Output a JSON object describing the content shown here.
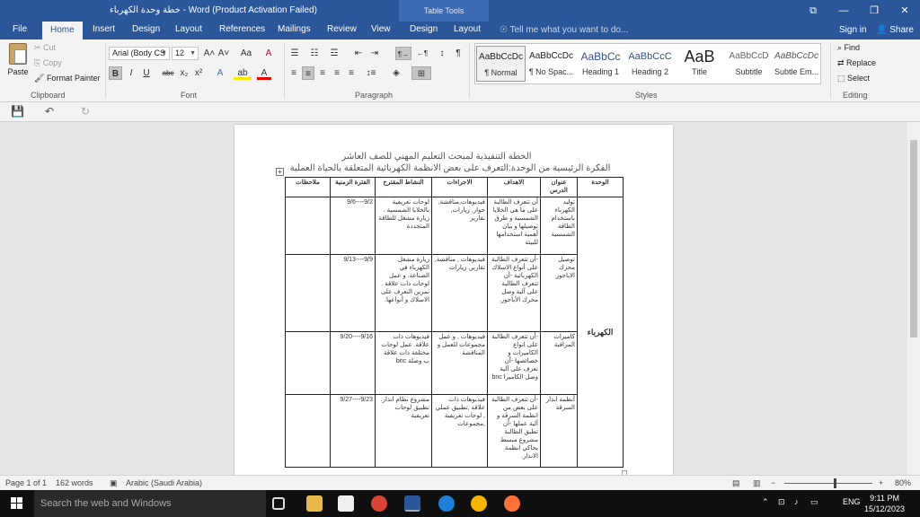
{
  "window": {
    "title": "خطة وحدة الكهرباء - Word (Product Activation Failed)",
    "context_tab": "Table Tools",
    "controls": [
      "⧉",
      "—",
      "❐",
      "✕"
    ]
  },
  "quick_access": {
    "save": "💾",
    "undo": "↶",
    "redo": "↻"
  },
  "tabs": [
    "File",
    "Home",
    "Insert",
    "Design",
    "Layout",
    "References",
    "Mailings",
    "Review",
    "View",
    "Design",
    "Layout"
  ],
  "active_tab": "Home",
  "tell_me": "Tell me what you want to do...",
  "sign_in": "Sign in",
  "share": "Share",
  "clipboard": {
    "label": "Clipboard",
    "paste": "Paste",
    "cut": "Cut",
    "copy": "Copy",
    "format_painter": "Format Painter"
  },
  "font": {
    "label": "Font",
    "name": "Arial (Body CS",
    "size": "12",
    "grow": "A˄",
    "shrink": "A˅",
    "change_case": "Aa",
    "clear": "A",
    "bold": "B",
    "italic": "I",
    "underline": "U",
    "strike": "abc",
    "subscript": "x₂",
    "superscript": "x²",
    "effects": "A",
    "highlight": "ab",
    "color": "A"
  },
  "paragraph": {
    "label": "Paragraph",
    "bullets": "☰",
    "numbering": "☷",
    "multilevel": "☲",
    "decrease_indent": "⇤",
    "increase_indent": "⇥",
    "ltr": "¶→",
    "rtl": "←¶",
    "sort": "↕",
    "show_marks": "¶",
    "align_left": "≡",
    "align_center": "≡",
    "align_right": "≡",
    "justify": "≡",
    "distributed": "≡",
    "line_spacing": "↕≡",
    "shading": "◈",
    "borders": "⊞"
  },
  "styles": {
    "label": "Styles",
    "items": [
      {
        "sample": "AaBbCcDc",
        "name": "¶ Normal"
      },
      {
        "sample": "AaBbCcDc",
        "name": "¶ No Spac..."
      },
      {
        "sample": "AaBbCc",
        "name": "Heading 1"
      },
      {
        "sample": "AaBbCcC",
        "name": "Heading 2"
      },
      {
        "sample": "AaB",
        "name": "Title"
      },
      {
        "sample": "AaBbCcD",
        "name": "Subtitle"
      },
      {
        "sample": "AaBbCcDc",
        "name": "Subtle Em..."
      }
    ]
  },
  "editing": {
    "label": "Editing",
    "find": "Find",
    "replace": "Replace",
    "select": "Select"
  },
  "document": {
    "title_line": "الخطة التنفيذية لمبحث التعليم المهني للصف العاشر",
    "subtitle_line": "الفكرة الرئيسية من الوحدة:التعرف على بعض الانظمة الكهربائية المتعلقة بالحياة العملية",
    "table": {
      "headers": [
        "الوحدة",
        "عنوان الدرس",
        "الاهداف",
        "الاجراءات",
        "النشاط المقترح",
        "الفترة الزمنية",
        "ملاحظات"
      ],
      "unit": "الكهرباء",
      "rows": [
        {
          "lesson": "توليد الكهرباء باستخدام الطاقة الشمسية",
          "goals": "أن تتعرف الطالبة على ما هي الخلايا الشمسية و طرق توصيلها و بيان أهمية استخدامها للبيئة",
          "procedures": "فيديوهات,مناقشة, حوار, زيارات, تقارير",
          "activity": "لوحات تعريفية بالخلايا الشمسية . زيارة مشغل للطاقة المتجددة",
          "period": "9/2----9/6",
          "notes": ""
        },
        {
          "lesson": "توصيل محرك الاباجور",
          "goals": "-أن تتعرف الطالبة على أنواع الاسلاك الكهربائية -أن تتعرف الطالبة على آلية وصل محرك الأباجور.",
          "procedures": "فيديوهات , مناقشة, تقارير, زيارات",
          "activity": "زيارة مشغل الكهرباء في الصناعة. و عمل لوحات ذات علاقة . تمرين التعرف على الاسلاك و أنواعها.",
          "period": "9/9----9/13",
          "notes": ""
        },
        {
          "lesson": "كاميرات المراقبة",
          "goals": "-أن تتعرف الطالبة على انواع الكاميرات و خصائصها -أن تعرف على آلية وصل الكاميرا bnc",
          "procedures": "فيديوهات , و عمل مجموعات للعمل و المناقشة",
          "activity": "فيديوهات ذات علاقة. عمل لوحات مختلفة ذات علاقة ب وصلة bnc",
          "period": "9/16----9/20",
          "notes": ""
        },
        {
          "lesson": "أنظمة انذار السرقة",
          "goals": "-أن تتعرف الطالبة على بعض من انظمة السرقة و آلية عملها -أن تطبق الطالبة مشروع مبسط يحاكي انظمة الانذار.",
          "procedures": "فيديوهات ذات علاقة ,تطبيق عملي , لوحات تعريفية ,مجموعات",
          "activity": "مشروع نظام انذار. تطبيق لوحات تعريفية",
          "period": "9/23----9/27",
          "notes": ""
        }
      ]
    }
  },
  "status": {
    "page": "Page 1 of 1",
    "words": "162 words",
    "language": "Arabic (Saudi Arabia)",
    "zoom": "80%",
    "zoom_minus": "−",
    "zoom_plus": "+"
  },
  "taskbar": {
    "search_placeholder": "Search the web and Windows",
    "language": "ENG",
    "time": "9:11 PM",
    "date": "15/12/2023",
    "tray_caret": "⌃",
    "tray_network": "⊡",
    "tray_volume": "♪",
    "tray_message": "▭"
  },
  "colors": {
    "accent": "#2b579a",
    "taskbar": "#101010"
  }
}
